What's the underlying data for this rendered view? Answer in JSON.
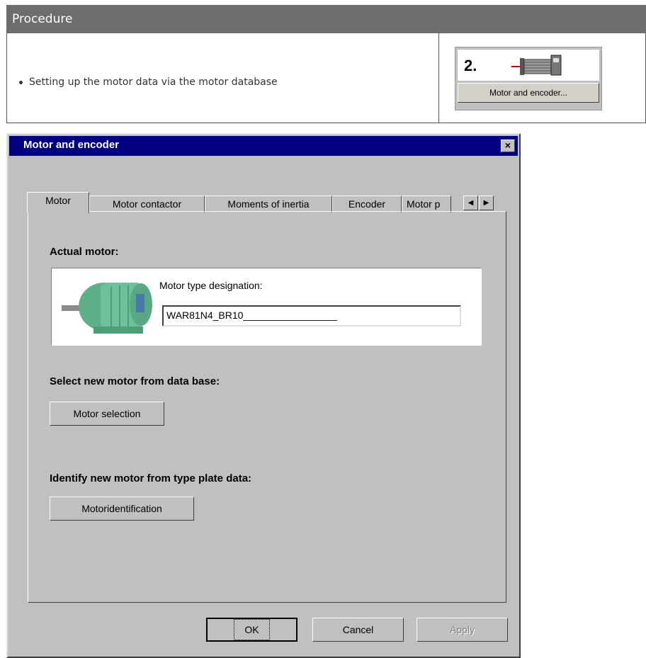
{
  "procedure": {
    "header": "Procedure",
    "bullet": "Setting up the motor data via the motor database",
    "step_number": "2.",
    "step_button": "Motor and encoder..."
  },
  "dialog": {
    "title": "Motor and encoder",
    "close_label": "×",
    "tabs": [
      "Motor",
      "Motor contactor",
      "Moments of inertia",
      "Encoder",
      "Motor p"
    ],
    "actual_motor_label": "Actual motor:",
    "motor_type_label": "Motor type designation:",
    "motor_type_value": "WAR81N4_BR10_________________",
    "select_label": "Select new motor from data base:",
    "motor_selection_button": "Motor selection",
    "identify_label": "Identify new motor from type plate data:",
    "motor_identification_button": "Motoridentification",
    "ok_button": "OK",
    "cancel_button": "Cancel",
    "apply_button": "Apply"
  },
  "colors": {
    "title_bar": "#000080",
    "dialog_bg": "#c0c0c0",
    "header_bg": "#6d6d6d"
  }
}
